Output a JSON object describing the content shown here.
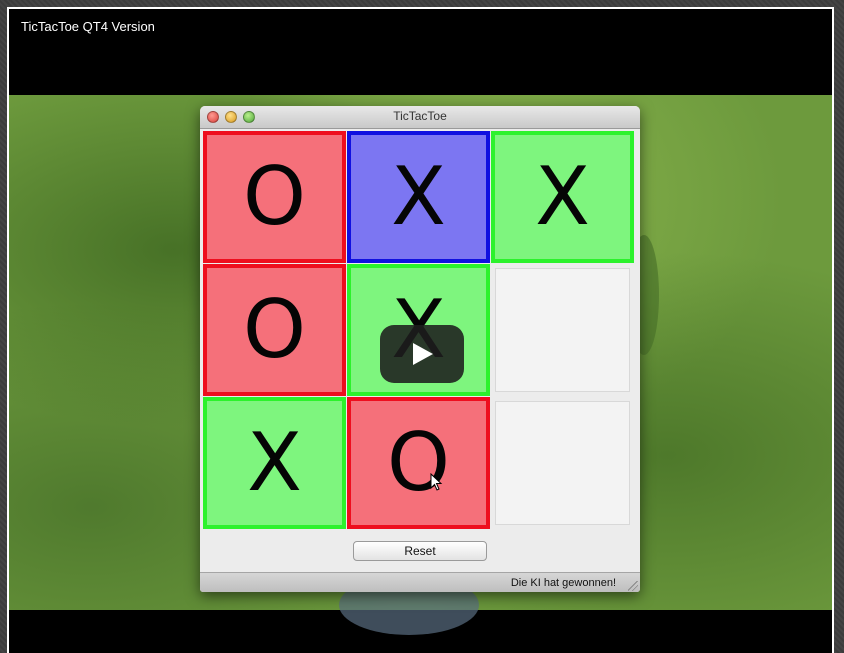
{
  "video": {
    "title": "TicTacToe QT4 Version"
  },
  "window": {
    "title": "TicTacToe",
    "reset_label": "Reset",
    "status": "Die KI hat gewonnen!"
  },
  "board": {
    "cells": [
      {
        "mark": "O",
        "color": "red"
      },
      {
        "mark": "X",
        "color": "blue"
      },
      {
        "mark": "X",
        "color": "green"
      },
      {
        "mark": "O",
        "color": "red"
      },
      {
        "mark": "X",
        "color": "green"
      },
      {
        "mark": "",
        "color": "empty"
      },
      {
        "mark": "X",
        "color": "green"
      },
      {
        "mark": "O",
        "color": "red"
      },
      {
        "mark": "",
        "color": "empty"
      }
    ]
  },
  "colors": {
    "red_fill": "#f5707a",
    "red_border": "#ee0e1e",
    "blue_fill": "#7c76f2",
    "blue_border": "#1010e0",
    "green_fill": "#7ef57e",
    "green_border": "#2cf22c"
  },
  "icons": {
    "play": "play-icon",
    "close": "close-icon",
    "minimize": "minimize-icon",
    "maximize": "maximize-icon",
    "cursor": "mouse-cursor-icon"
  }
}
